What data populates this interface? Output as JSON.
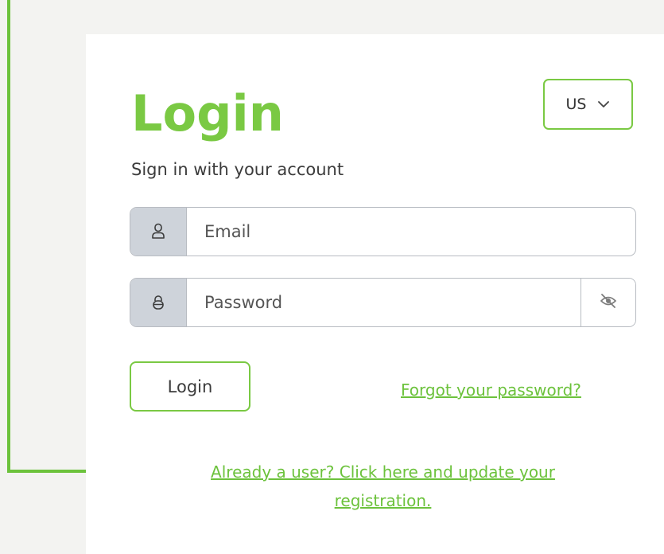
{
  "login": {
    "title": "Login",
    "subtitle": "Sign in with your account",
    "language": {
      "selected": "US"
    },
    "email": {
      "placeholder": "Email"
    },
    "password": {
      "placeholder": "Password"
    },
    "submit_label": "Login",
    "forgot_label": "Forgot your password?",
    "register_label": "Already a user? Click here and update your registration."
  },
  "icons": {
    "email_icon": "user-icon",
    "password_icon": "lock-icon",
    "toggle_icon": "eye-off-icon",
    "select_icon": "chevron-down-icon"
  },
  "colors": {
    "accent": "#7ac943",
    "link": "#6cc23c",
    "addon_bg": "#ced3da",
    "page_bg": "#f3f3f1"
  }
}
